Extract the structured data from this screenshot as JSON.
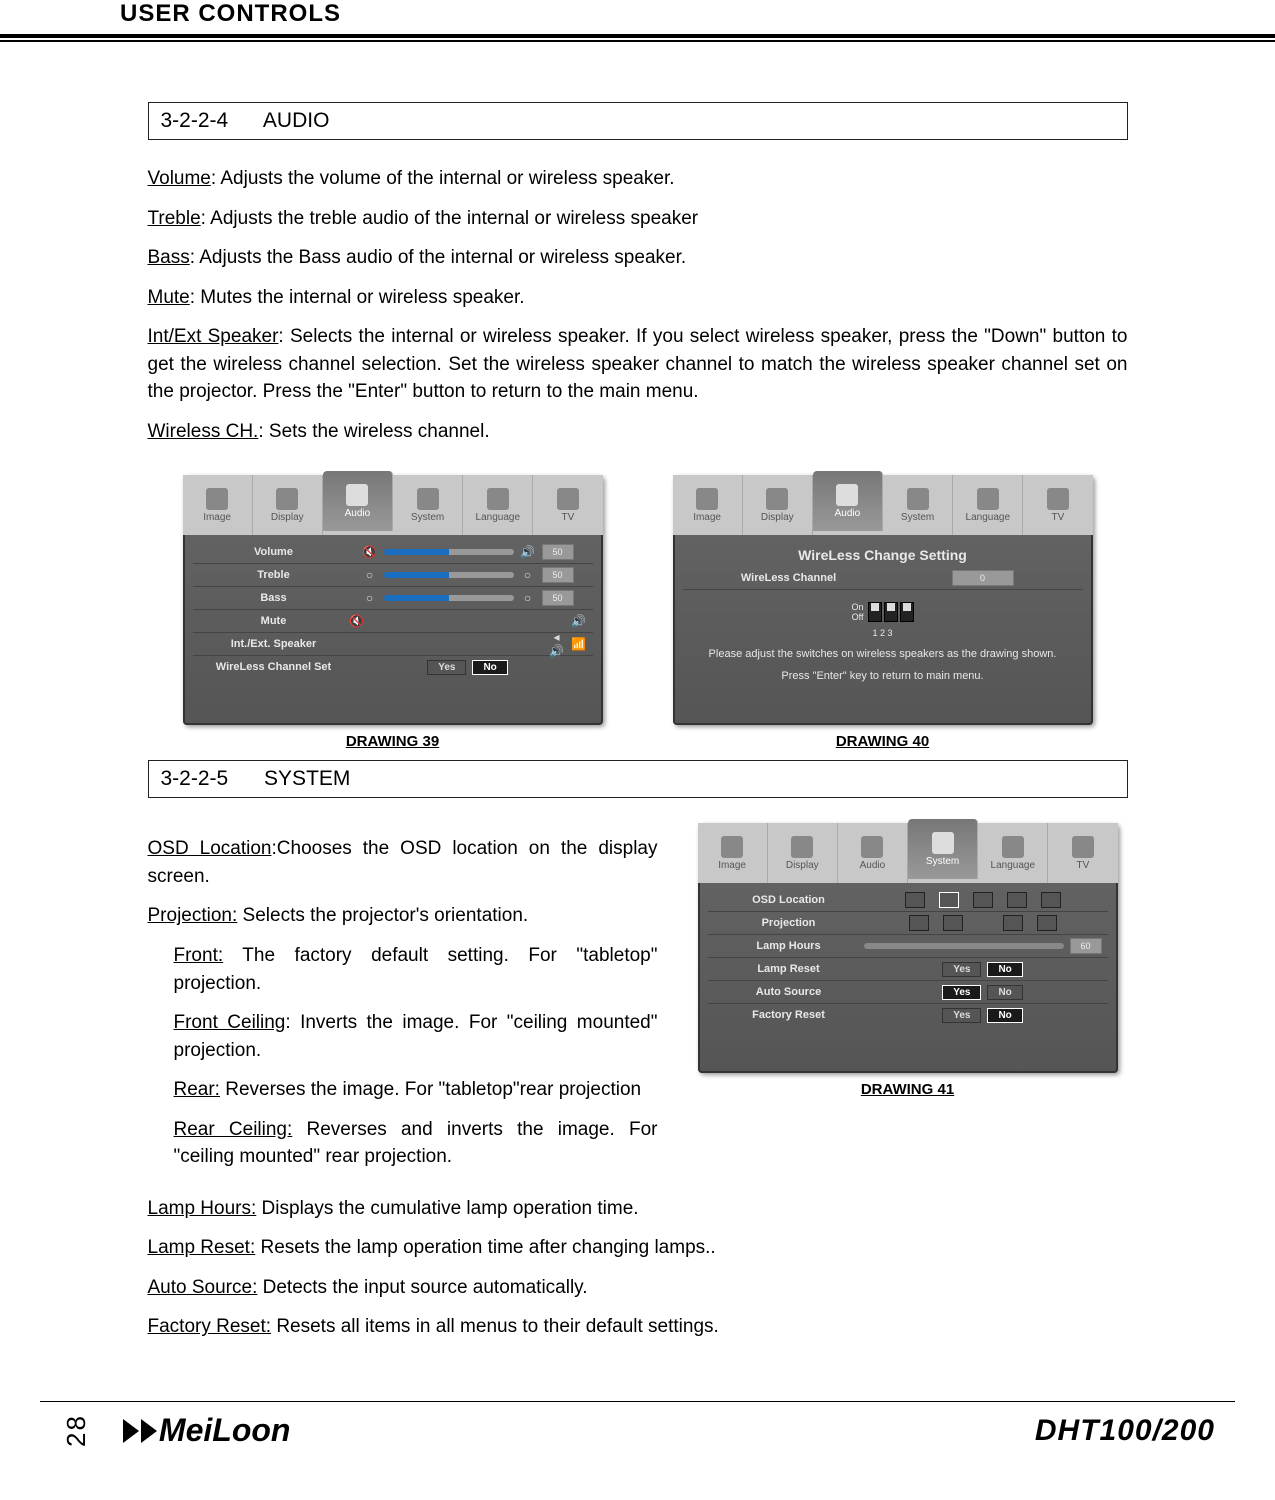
{
  "header": "USER CONTROLS",
  "section1": {
    "num": "3-2-2-4",
    "title": "AUDIO"
  },
  "audio": {
    "volume": {
      "term": "Volume",
      "text": ": Adjusts the volume of the internal or wireless speaker."
    },
    "treble": {
      "term": "Treble",
      "text": ": Adjusts the treble audio of the internal or wireless speaker"
    },
    "bass": {
      "term": "Bass",
      "text": ": Adjusts the Bass audio of the internal or wireless speaker."
    },
    "mute": {
      "term": "Mute",
      "text": ": Mutes the internal or wireless speaker."
    },
    "intext": {
      "term": "Int/Ext Speaker",
      "text": ": Selects the internal or wireless speaker. If you select wireless speaker, press the \"Down\" button to get the wireless channel selection. Set the wireless speaker channel to match the wireless speaker channel set on the projector. Press the \"Enter\" button to return to the main menu."
    },
    "wireless": {
      "term": "Wireless CH.",
      "text": ": Sets the wireless channel."
    }
  },
  "osd1": {
    "tabs": [
      "Image",
      "Display",
      "Audio",
      "System",
      "Language",
      "TV"
    ],
    "activeTab": "Audio",
    "rows": {
      "volume": {
        "label": "Volume",
        "value": "50"
      },
      "treble": {
        "label": "Treble",
        "value": "50"
      },
      "bass": {
        "label": "Bass",
        "value": "50"
      },
      "mute": {
        "label": "Mute"
      },
      "intext": {
        "label": "Int./Ext. Speaker"
      },
      "wlset": {
        "label": "WireLess Channel Set",
        "yes": "Yes",
        "no": "No"
      }
    },
    "caption": "DRAWING 39"
  },
  "osd2": {
    "title": "WireLess Change Setting",
    "channelLabel": "WireLess Channel",
    "channelValue": "0",
    "on": "On",
    "off": "Off",
    "nums": "1 2 3",
    "msg1": "Please adjust the switches on wireless speakers as the drawing shown.",
    "msg2": "Press \"Enter\" key to return to main menu.",
    "caption": "DRAWING 40"
  },
  "section2": {
    "num": "3-2-2-5",
    "title": "SYSTEM"
  },
  "system": {
    "osdloc": {
      "term": "OSD Location",
      "text": ":Chooses the OSD location on the display screen."
    },
    "proj": {
      "term": "Projection:",
      "text": " Selects the projector's orientation."
    },
    "front": {
      "term": "Front:",
      "text": " The factory default setting. For \"tabletop\" projection."
    },
    "frontc": {
      "term": "Front Ceiling",
      "text": ": Inverts the image. For \"ceiling mounted\" projection."
    },
    "rear": {
      "term": "Rear:",
      "text": " Reverses the image. For \"tabletop\"rear projection"
    },
    "rearc": {
      "term": "Rear Ceiling:",
      "text": " Reverses and inverts the image. For \"ceiling mounted\" rear projection."
    },
    "lamph": {
      "term": "Lamp Hours:",
      "text": " Displays the cumulative lamp operation time."
    },
    "lampr": {
      "term": "Lamp Reset:",
      "text": " Resets the lamp operation time after changing lamps.."
    },
    "autos": {
      "term": "Auto Source:",
      "text": " Detects the input source automatically."
    },
    "factr": {
      "term": "Factory Reset:",
      "text": " Resets all items in all menus to their default settings."
    }
  },
  "osd3": {
    "activeTab": "System",
    "rows": {
      "osdloc": {
        "label": "OSD Location"
      },
      "proj": {
        "label": "Projection"
      },
      "lamph": {
        "label": "Lamp Hours",
        "value": "60"
      },
      "lampr": {
        "label": "Lamp Reset",
        "yes": "Yes",
        "no": "No"
      },
      "autos": {
        "label": "Auto Source",
        "yes": "Yes",
        "no": "No"
      },
      "factr": {
        "label": "Factory Reset",
        "yes": "Yes",
        "no": "No"
      }
    },
    "caption": "DRAWING 41"
  },
  "footer": {
    "page": "28",
    "logo": "MeiLoon",
    "model": "DHT100/200"
  }
}
